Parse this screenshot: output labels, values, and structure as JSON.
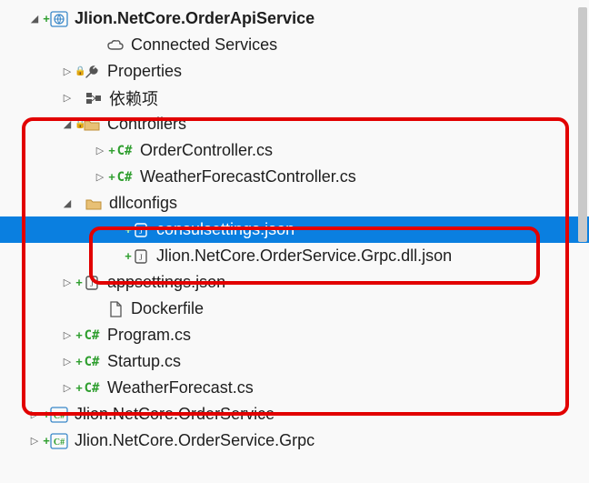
{
  "tree": {
    "project": "Jlion.NetCore.OrderApiService",
    "connectedServices": "Connected Services",
    "properties": "Properties",
    "dependencies": "依赖项",
    "controllers": "Controllers",
    "orderController": "OrderController.cs",
    "weatherForecastController": "WeatherForecastController.cs",
    "dllconfigs": "dllconfigs",
    "consulSettings": "consulsettings.json",
    "orderServiceDllJson": "Jlion.NetCore.OrderService.Grpc.dll.json",
    "appsettings": "appsettings.json",
    "dockerfile": "Dockerfile",
    "program": "Program.cs",
    "startup": "Startup.cs",
    "weatherForecast": "WeatherForecast.cs",
    "orderService": "Jlion.NetCore.OrderService",
    "orderServiceGrpc": "Jlion.NetCore.OrderService.Grpc"
  }
}
